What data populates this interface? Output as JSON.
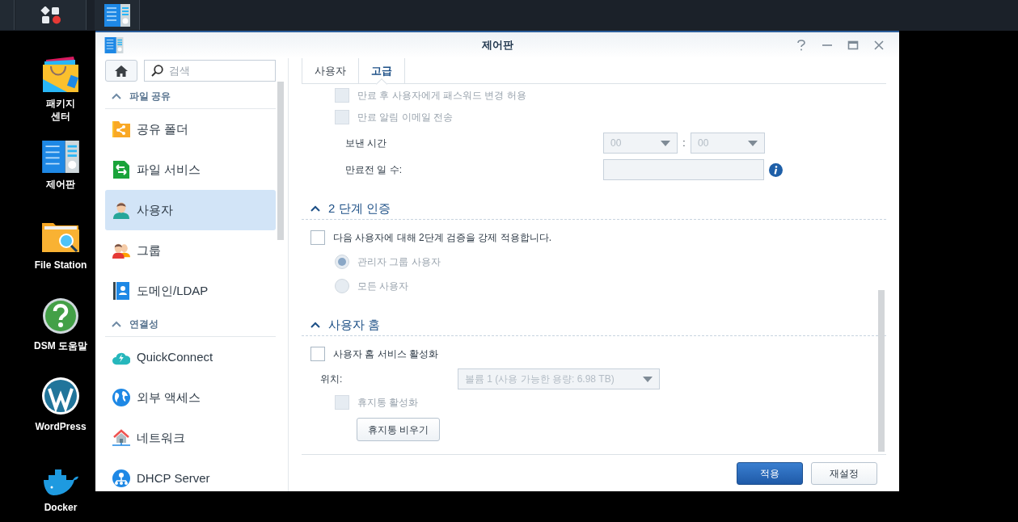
{
  "desktop_icons": [
    {
      "label": "패키지\n센터",
      "kind": "package"
    },
    {
      "label": "제어판",
      "kind": "control_panel"
    },
    {
      "label": "File Station",
      "kind": "file_station"
    },
    {
      "label": "DSM 도움말",
      "kind": "help"
    },
    {
      "label": "WordPress",
      "kind": "wordpress"
    },
    {
      "label": "Docker",
      "kind": "docker"
    }
  ],
  "window": {
    "title": "제어판"
  },
  "sidebar": {
    "search": {
      "placeholder": "검색"
    },
    "sections": [
      {
        "title": "파일 공유",
        "expanded": true,
        "items": [
          {
            "label": "공유 폴더",
            "kind": "shared_folder",
            "selected": false
          },
          {
            "label": "파일 서비스",
            "kind": "file_services",
            "selected": false
          },
          {
            "label": "사용자",
            "kind": "user",
            "selected": true
          },
          {
            "label": "그룹",
            "kind": "group",
            "selected": false
          },
          {
            "label": "도메인/LDAP",
            "kind": "domain",
            "selected": false
          }
        ]
      },
      {
        "title": "연결성",
        "expanded": true,
        "items": [
          {
            "label": "QuickConnect",
            "kind": "quickconnect",
            "selected": false
          },
          {
            "label": "외부 액세스",
            "kind": "globe",
            "selected": false
          },
          {
            "label": "네트워크",
            "kind": "network",
            "selected": false
          },
          {
            "label": "DHCP Server",
            "kind": "dhcp",
            "selected": false
          }
        ]
      }
    ]
  },
  "tabs": [
    {
      "label": "사용자",
      "selected": false
    },
    {
      "label": "고급",
      "selected": true
    }
  ],
  "expiry_options": [
    {
      "label": "만료 후 사용자에게 패스워드 변경 허용",
      "checked": false,
      "disabled": true
    },
    {
      "label": "만료 알림 이메일 전송",
      "checked": false,
      "disabled": true
    }
  ],
  "send_time": {
    "label": "보낸 시간",
    "hour": "00",
    "separator": ":",
    "minute": "00"
  },
  "days_before": {
    "label": "만료전 일 수:"
  },
  "two_step": {
    "title": "2 단계 인증",
    "expanded": true,
    "enforce": {
      "label": "다음 사용자에 대해 2단계 검증을 강제 적용합니다.",
      "checked": false
    },
    "options": [
      {
        "label": "관리자 그룹 사용자",
        "selected": true,
        "disabled": true
      },
      {
        "label": "모든 사용자",
        "selected": false,
        "disabled": true
      }
    ]
  },
  "user_home": {
    "title": "사용자 홈",
    "expanded": true,
    "enable": {
      "label": "사용자 홈 서비스 활성화",
      "checked": false
    },
    "location": {
      "label": "위치:",
      "value": "볼륨 1 (사용 가능한 용량: 6.98 TB)"
    },
    "recycle_bin": {
      "label": "휴지통 활성화",
      "checked": false,
      "disabled": true
    },
    "empty_button": "휴지통 비우기"
  },
  "footer_buttons": [
    {
      "label": "적용",
      "kind": "primary"
    },
    {
      "label": "재설정",
      "kind": "secondary"
    }
  ]
}
